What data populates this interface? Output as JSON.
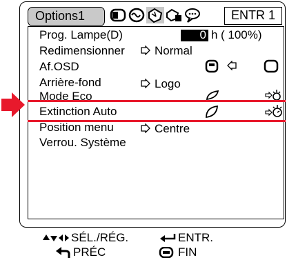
{
  "header": {
    "tab_title": "Options1",
    "enter_tab": "ENTR 1"
  },
  "menu": {
    "items": [
      {
        "label": "Prog. Lampe(D)",
        "value": "0",
        "unit": "h",
        "percent": "( 100%)"
      },
      {
        "label": "Redimensionner",
        "value": "Normal"
      },
      {
        "label": "Af.OSD",
        "value": ""
      },
      {
        "label": "Arrière-fond",
        "value": "Logo"
      },
      {
        "label": "Mode Eco",
        "value": ""
      },
      {
        "label": "Extinction Auto",
        "value": ""
      },
      {
        "label": "Position menu",
        "value": "Centre"
      },
      {
        "label": "Verrou. Système",
        "value": ""
      }
    ]
  },
  "footer": {
    "select_adjust": "SÉL./RÉG.",
    "enter": "ENTR.",
    "back": "PRÉC",
    "end": "FIN"
  },
  "colors": {
    "highlight": "#e8192c",
    "tab_background": "#c9c9c9"
  },
  "icons": [
    "picture-tab-icon",
    "sound-tab-icon",
    "options1-tab-icon",
    "options2-tab-icon",
    "language-tab-icon",
    "osd-on-icon",
    "osd-off-icon",
    "eco-on-icon",
    "eco-off-icon",
    "auto-power-off-on-icon",
    "auto-power-off-off-icon",
    "arrow-keys-icon",
    "enter-icon",
    "return-icon",
    "menu-icon"
  ]
}
